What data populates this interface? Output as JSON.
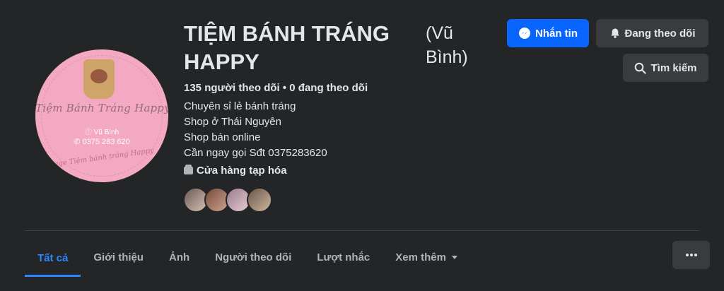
{
  "page": {
    "title": "TIỆM BÁNH TRÁNG HAPPY",
    "alternate_name": "(Vũ Bình)",
    "follow_stats": "135 người theo dõi • 0 đang theo dõi",
    "bio": [
      "Chuyên sỉ lẻ bánh tráng",
      "Shop ở Thái Nguyên",
      "Shop bán online",
      "Cần ngay gọi Sđt 0375283620"
    ],
    "category": "Cửa hàng tạp hóa",
    "avatar": {
      "shop_name": "Tiệm Bánh Tráng Happy",
      "facebook_name": "Vũ Bình",
      "phone": "0375 283 620",
      "bottom_text": "Page Tiệm bánh tráng Happy"
    }
  },
  "actions": {
    "message": "Nhắn tin",
    "following": "Đang theo dõi",
    "search": "Tìm kiếm"
  },
  "tabs": [
    {
      "label": "Tất cả",
      "active": true
    },
    {
      "label": "Giới thiệu"
    },
    {
      "label": "Ảnh"
    },
    {
      "label": "Người theo dõi"
    },
    {
      "label": "Lượt nhắc"
    },
    {
      "label": "Xem thêm"
    }
  ],
  "follower_avatars": [
    {
      "colors": [
        "#6b5a55",
        "#d8c2b4"
      ]
    },
    {
      "colors": [
        "#7a4a3a",
        "#caa590"
      ]
    },
    {
      "colors": [
        "#9a7b8a",
        "#e7cdd6"
      ]
    },
    {
      "colors": [
        "#6a5647",
        "#cdb8a0"
      ]
    }
  ],
  "colors": {
    "background": "#242526",
    "primary": "#0866ff",
    "active_tab": "#2d88ff",
    "secondary_button": "#3a3b3c"
  },
  "icons": {
    "message": "messenger-icon",
    "following": "bell-icon",
    "search": "search-icon",
    "category": "shop-icon",
    "more_tab": "caret-down-icon",
    "more_button": "more-horizontal-icon"
  }
}
